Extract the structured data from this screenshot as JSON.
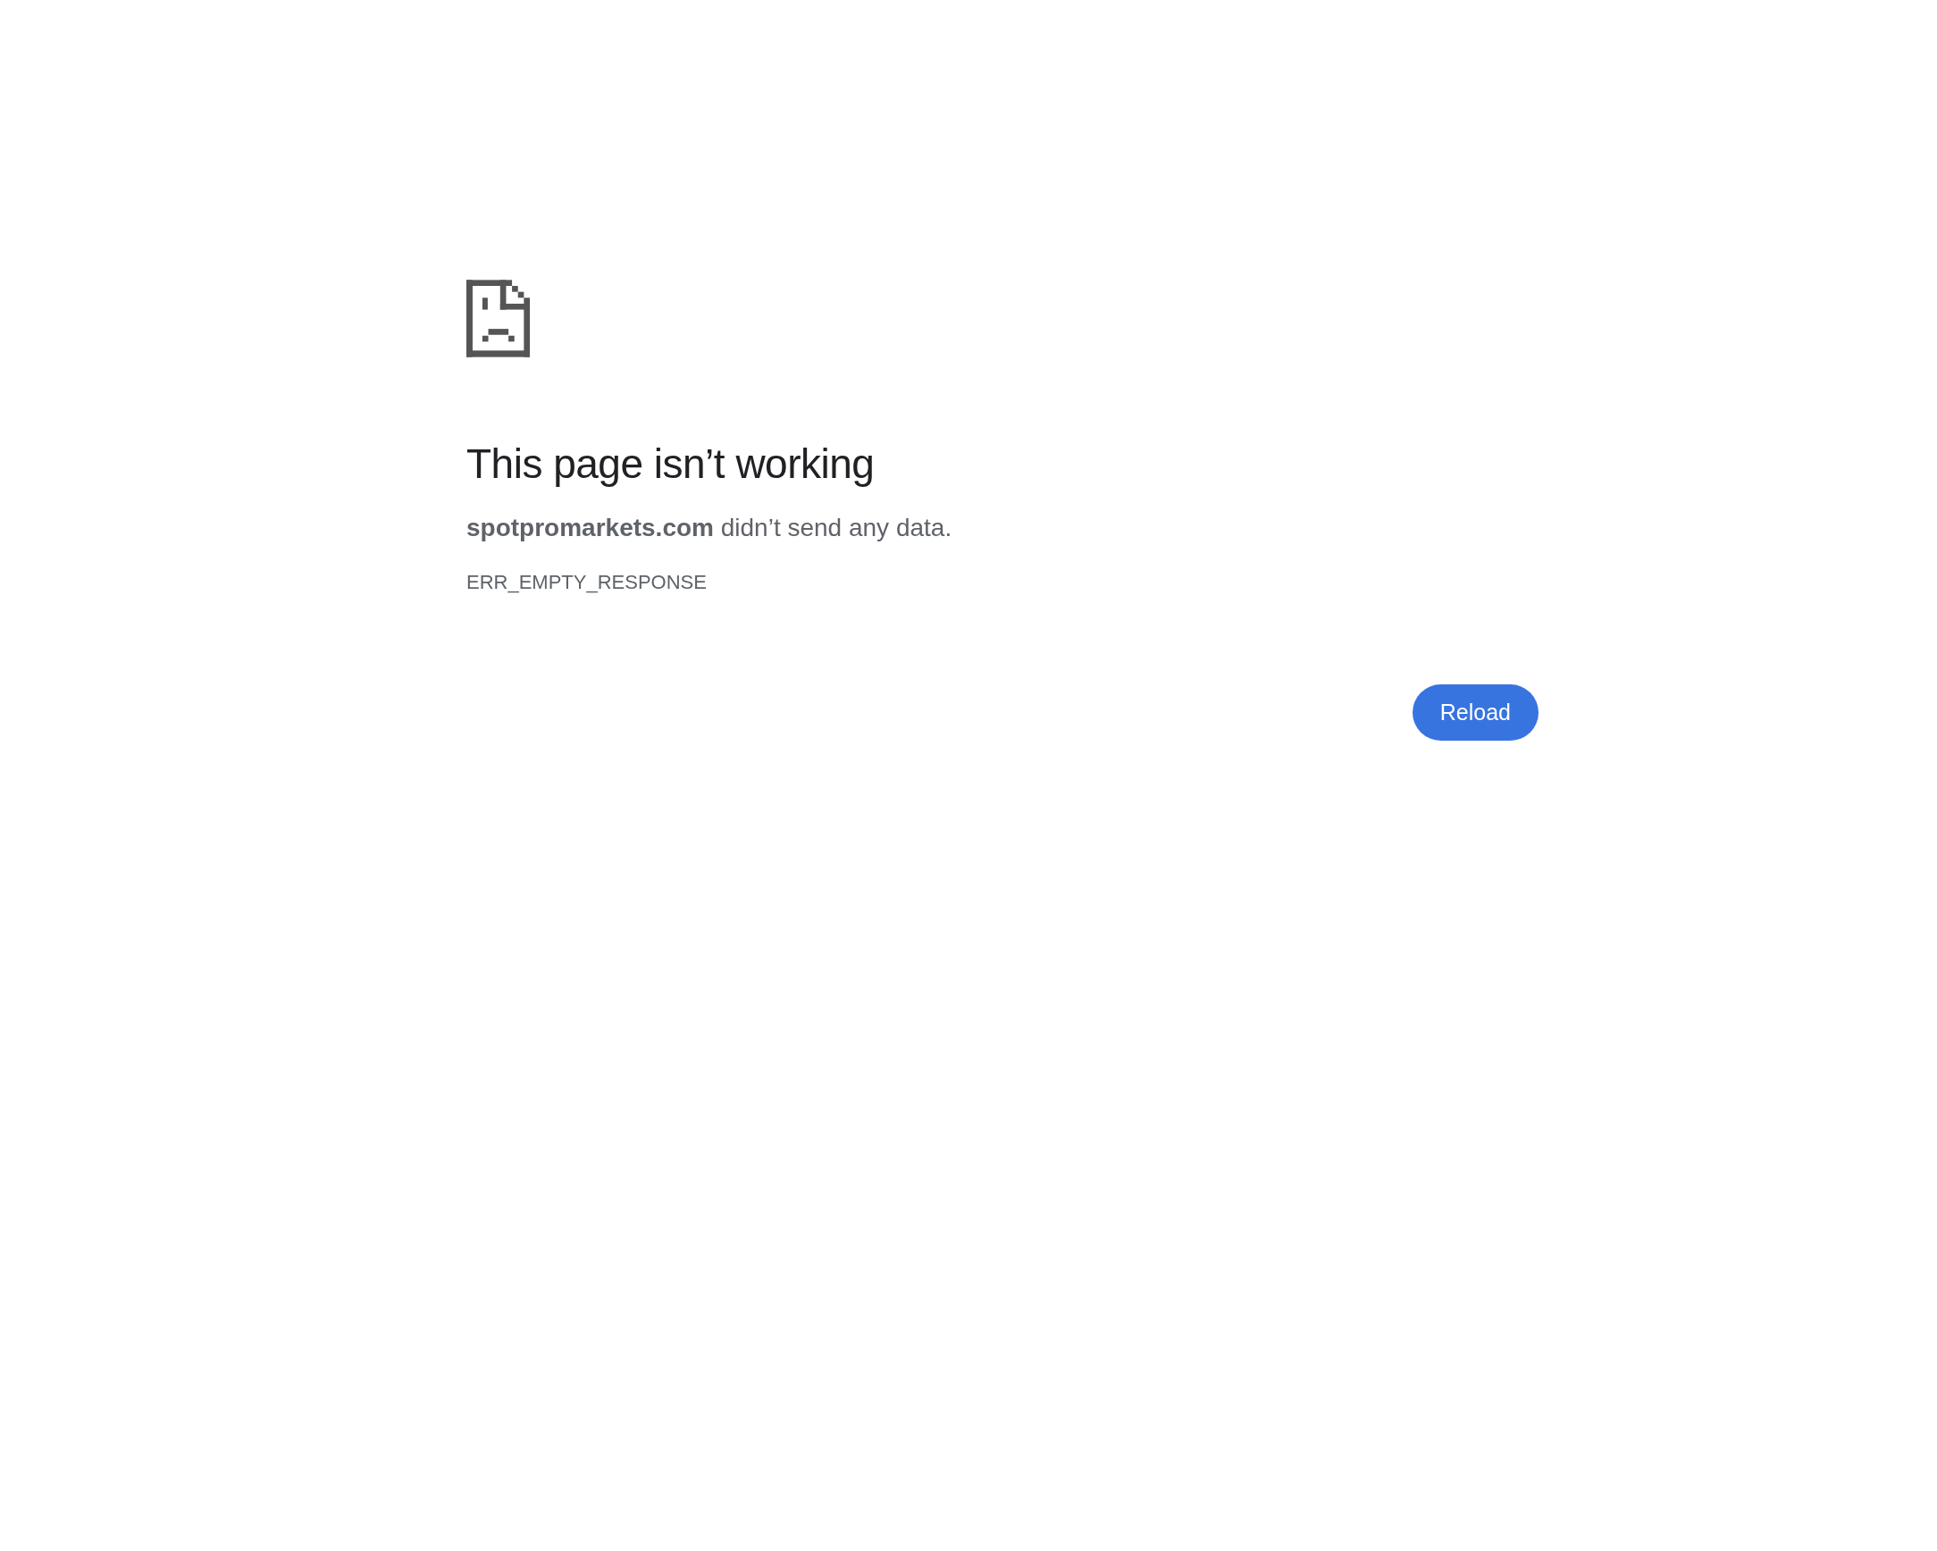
{
  "title": "This page isn’t working",
  "message": "**spotpromarkets.com** didn’t send any data.",
  "error_code": "ERR_EMPTY_RESPONSE",
  "buttons": [
    "Reload"
  ]
}
